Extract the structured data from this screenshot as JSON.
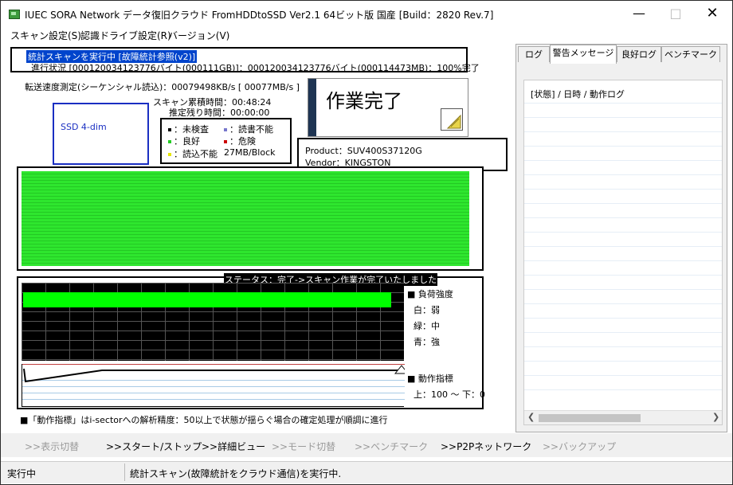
{
  "window": {
    "title": "IUEC SORA Network データ復旧クラウド FromHDDtoSSD Ver2.1 64ビット版 国産 [Build：2820 Rev.7]",
    "minimize_icon": "minimize-icon",
    "maximize_icon": "maximize-icon",
    "close_icon": "close-icon"
  },
  "menu": [
    {
      "label": "スキャン設定(S)"
    },
    {
      "label": "認識ドライブ設定(R)"
    },
    {
      "label": "バージョン(V)"
    }
  ],
  "scan": {
    "heading": "統計スキャンを実行中 [故障統計参照(v2)]",
    "progress": "進行状況 [000120034123776バイト(000111GB)]：000120034123776バイト(000114473MB)：100%完了",
    "progress_percent": 100,
    "speed": "転送速度測定(シーケンシャル読込)：00079498KB/s [ 00077MB/s ]",
    "elapsed": "スキャン累積時間：00:48:24",
    "remaining": "推定残り時間：00:00:00"
  },
  "drive": {
    "label": "SSD 4-dim",
    "product": "Product：SUV400S37120G",
    "vendor": "Vendor：KINGSTON"
  },
  "legend": {
    "unchecked": "：未検査",
    "write_fail": "：読書不能",
    "good": "：良好",
    "danger": "：危険",
    "read_fail": "：読込不能",
    "block_size": "27MB/Block",
    "colors": {
      "unchecked": "#000000",
      "write_fail": "#7777cc",
      "good": "#22cc22",
      "danger": "#cc0000",
      "read_fail": "#e6e600"
    }
  },
  "done_panel": {
    "text": "作業完了",
    "icon": "note-edit-icon"
  },
  "status": {
    "text": "ステータス：完了->スキャン作業が完了いたしました"
  },
  "load_graph": {
    "title": "負荷強度",
    "white": "白：弱",
    "green": "緑：中",
    "blue": "青：強",
    "level_fraction": 0.97,
    "bar_color": "#00ff00"
  },
  "activity": {
    "title": "動作指標",
    "range": "上：100 〜 下：0"
  },
  "hint": "■「動作指標」はi-sectorへの解析精度：50以上で状態が揺らぐ場合の確定処理が順調に進行",
  "tabs": [
    {
      "label": "ログ"
    },
    {
      "label": "警告メッセージ"
    },
    {
      "label": "良好ログ"
    },
    {
      "label": "ベンチマーク"
    }
  ],
  "log": {
    "header": "[状態] / 日時 / 動作ログ"
  },
  "toolbar": [
    {
      "label": ">>表示切替",
      "enabled": false
    },
    {
      "label": ">>スタート/ストップ",
      "enabled": true
    },
    {
      "label": ">>詳細ビュー",
      "enabled": true
    },
    {
      "label": ">>モード切替",
      "enabled": false
    },
    {
      "label": ">>ベンチマーク",
      "enabled": false
    },
    {
      "label": ">>P2Pネットワーク",
      "enabled": true
    },
    {
      "label": ">>バックアップ",
      "enabled": false
    }
  ],
  "statusbar": {
    "left": "実行中",
    "right": "統計スキャン(故障統計をクラウド通信)を実行中."
  }
}
